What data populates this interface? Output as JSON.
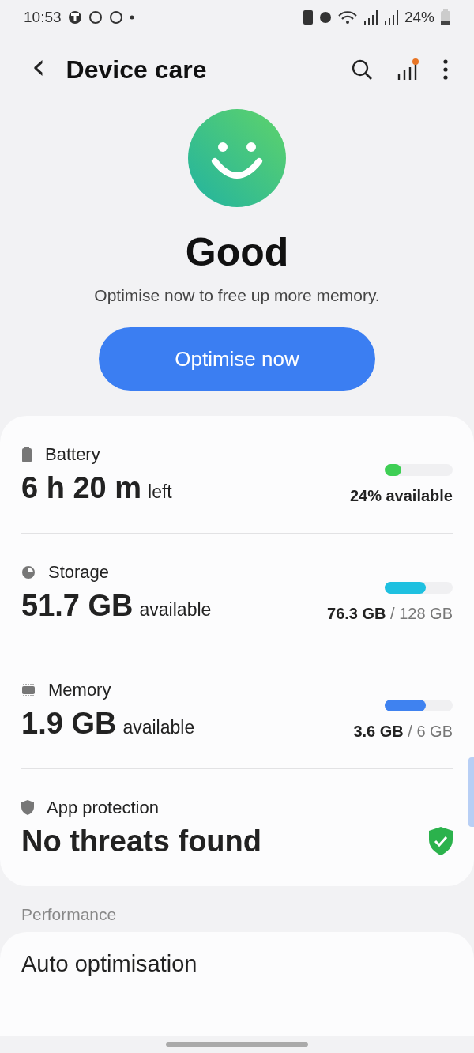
{
  "status_bar": {
    "time": "10:53",
    "battery": "24%"
  },
  "header": {
    "title": "Device care",
    "back": "‹"
  },
  "summary": {
    "status": "Good",
    "message": "Optimise now to free up more memory.",
    "button": "Optimise now"
  },
  "items": [
    {
      "kind": "meter",
      "label": "Battery",
      "value": "6 h 20 m",
      "unit": "left",
      "level": 0.24,
      "color": "#3fcf55",
      "used": "24% available"
    },
    {
      "kind": "meter",
      "label": "Storage",
      "value": "51.7 GB",
      "unit": "available",
      "level": 0.6,
      "color": "#1ec0e0",
      "used": "76.3 GB",
      "total": " / 128 GB"
    },
    {
      "kind": "meter",
      "label": "Memory",
      "value": "1.9 GB",
      "unit": "available",
      "level": 0.6,
      "color": "#3f82f0",
      "used": "3.6 GB",
      "total": " / 6 GB"
    },
    {
      "kind": "status",
      "label": "App protection",
      "value": "No threats found"
    }
  ],
  "section": {
    "title": "Performance",
    "items": [
      "Auto optimisation"
    ]
  }
}
